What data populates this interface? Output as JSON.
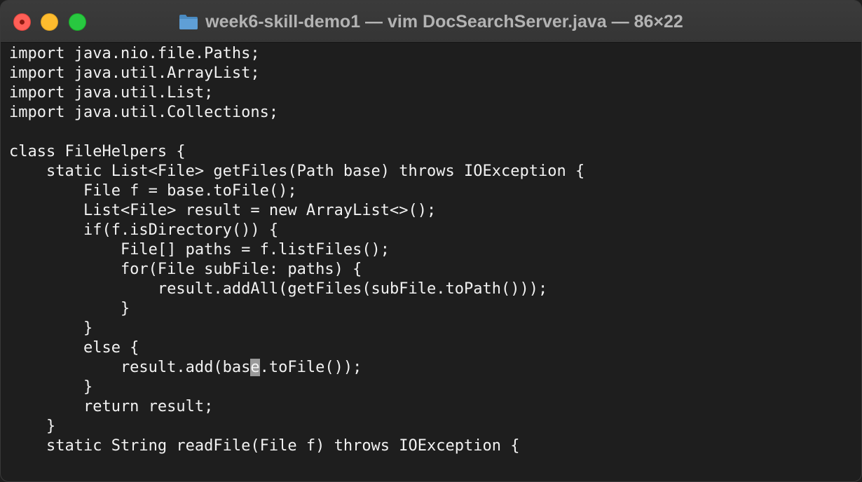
{
  "window": {
    "title": "week6-skill-demo1 — vim DocSearchServer.java — 86×22"
  },
  "icons": {
    "title_icon": "folder-icon"
  },
  "colors": {
    "background": "#1e1e1e",
    "text": "#f2f2f2",
    "cursor": "#9a9a9a",
    "close": "#ff5f57",
    "minimize": "#febc2e",
    "zoom": "#28c840"
  },
  "editor": {
    "lines": [
      "import java.nio.file.Paths;",
      "import java.util.ArrayList;",
      "import java.util.List;",
      "import java.util.Collections;",
      "",
      "class FileHelpers {",
      "    static List<File> getFiles(Path base) throws IOException {",
      "        File f = base.toFile();",
      "        List<File> result = new ArrayList<>();",
      "        if(f.isDirectory()) {",
      "            File[] paths = f.listFiles();",
      "            for(File subFile: paths) {",
      "                result.addAll(getFiles(subFile.toPath()));",
      "            }",
      "        }",
      "        else {",
      "            result.add(base.toFile());",
      "        }",
      "        return result;",
      "    }",
      "    static String readFile(File f) throws IOException {"
    ],
    "cursor": {
      "before": "            result.add(bas",
      "char": "e",
      "after": ".toFile());"
    }
  }
}
